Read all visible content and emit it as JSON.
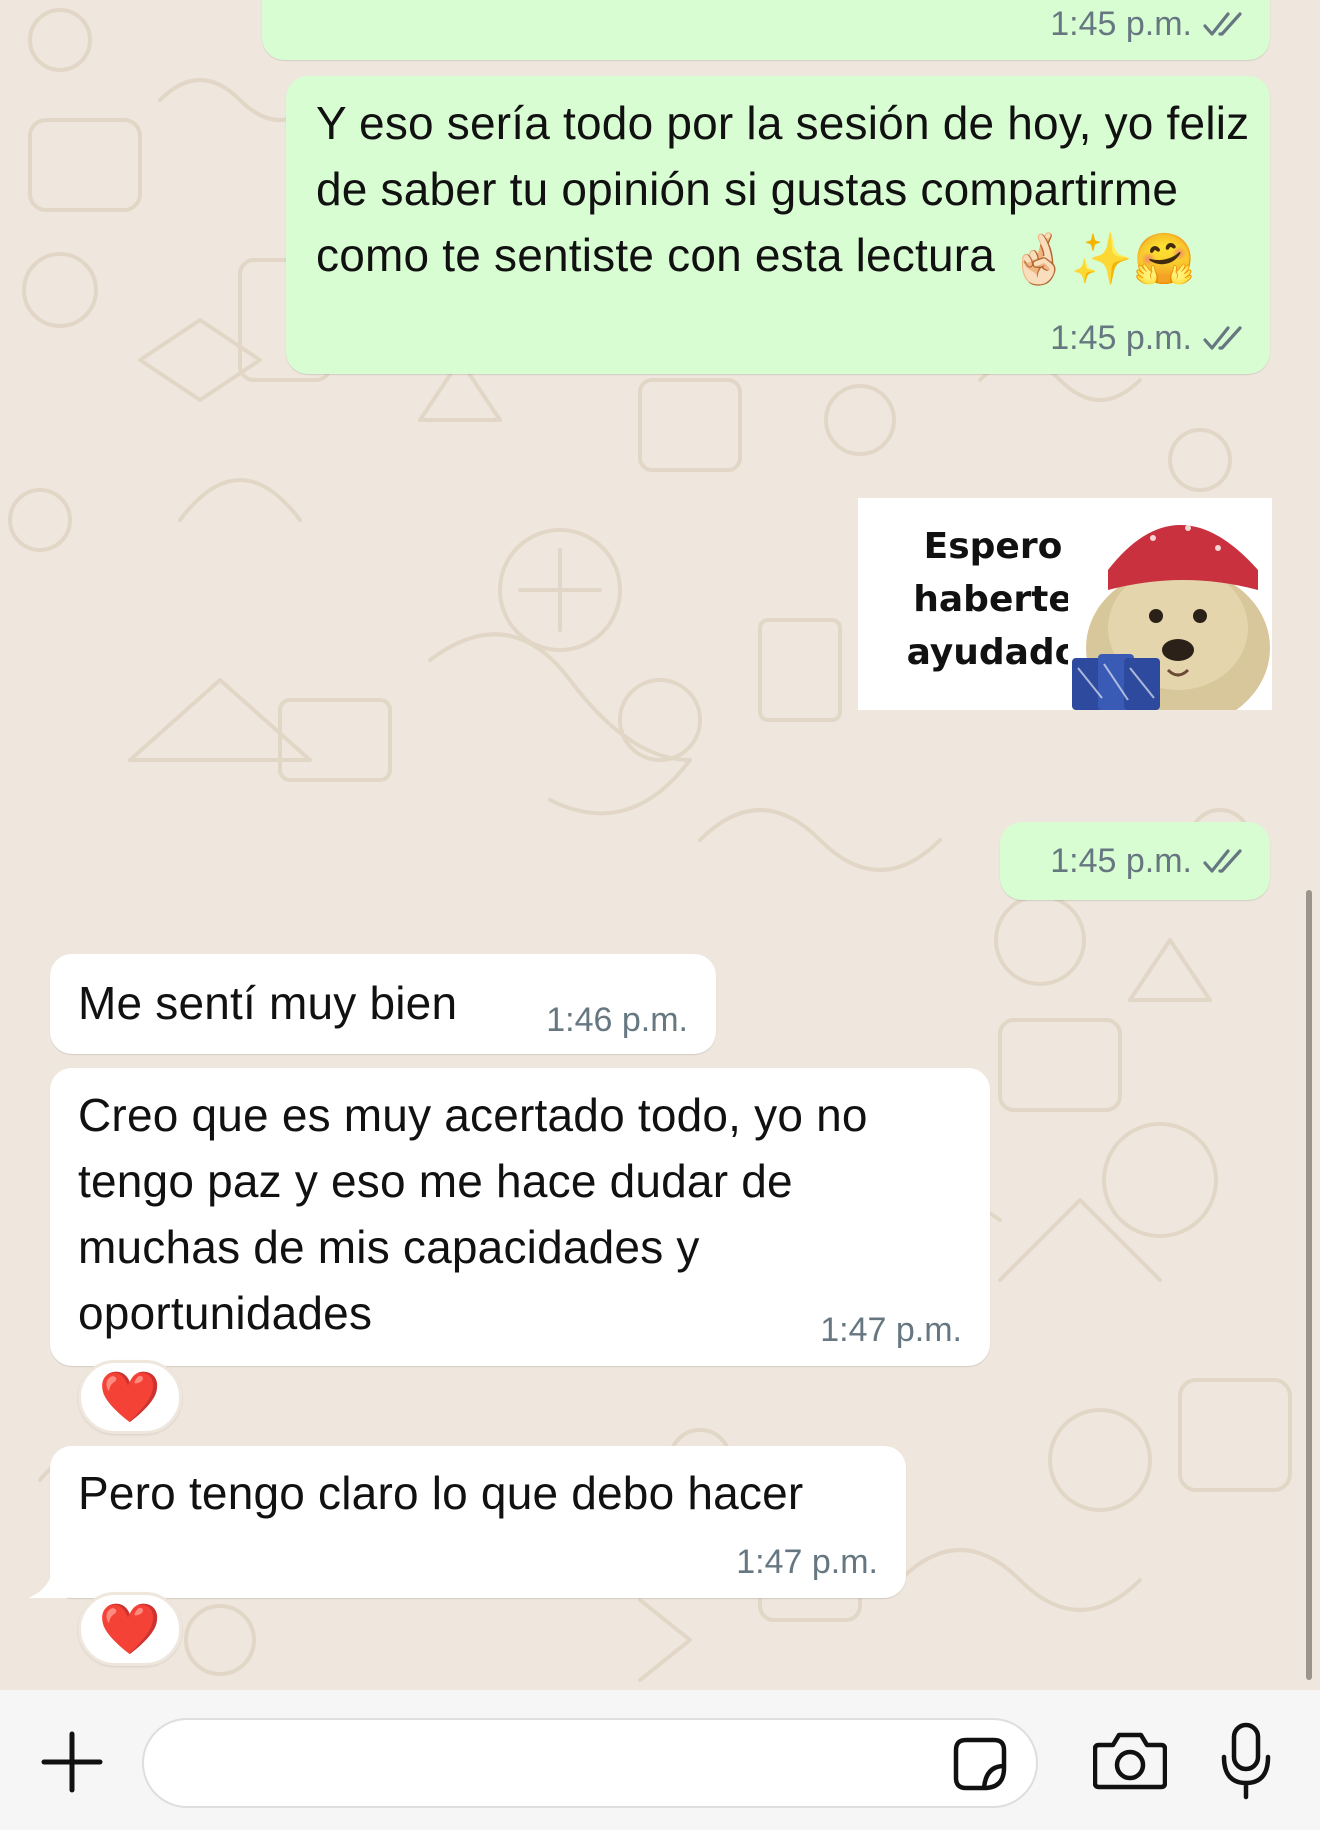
{
  "colors": {
    "outgoing_bubble": "#d9fdd3",
    "incoming_bubble": "#ffffff",
    "meta_text": "#667781",
    "read_ticks": "#667781"
  },
  "messages": [
    {
      "direction": "outgoing",
      "text": "",
      "time": "1:45 p.m.",
      "status": "read"
    },
    {
      "direction": "outgoing",
      "text": "Y eso sería todo por la sesión de hoy, yo feliz de saber tu opinión si gustas compartirme como te sentiste con esta lectura",
      "emojis": "🤞🏻✨🤗",
      "time": "1:45 p.m.",
      "status": "read"
    },
    {
      "direction": "outgoing",
      "type": "sticker",
      "sticker_text": "Espero\nhaberte\nayudado",
      "time": "1:45 p.m.",
      "status": "read"
    },
    {
      "direction": "incoming",
      "text": "Me sentí muy bien",
      "time": "1:46 p.m."
    },
    {
      "direction": "incoming",
      "text": "Creo que es muy acertado todo, yo no tengo paz y eso me hace dudar de muchas de mis capacidades y oportunidades",
      "time": "1:47 p.m.",
      "reaction": "❤️"
    },
    {
      "direction": "incoming",
      "text": "Pero tengo claro lo que debo hacer",
      "time": "1:47 p.m.",
      "reaction": "❤️"
    }
  ],
  "composer": {
    "placeholder": "",
    "icons": [
      "plus-icon",
      "sticker-icon",
      "camera-icon",
      "microphone-icon"
    ]
  }
}
